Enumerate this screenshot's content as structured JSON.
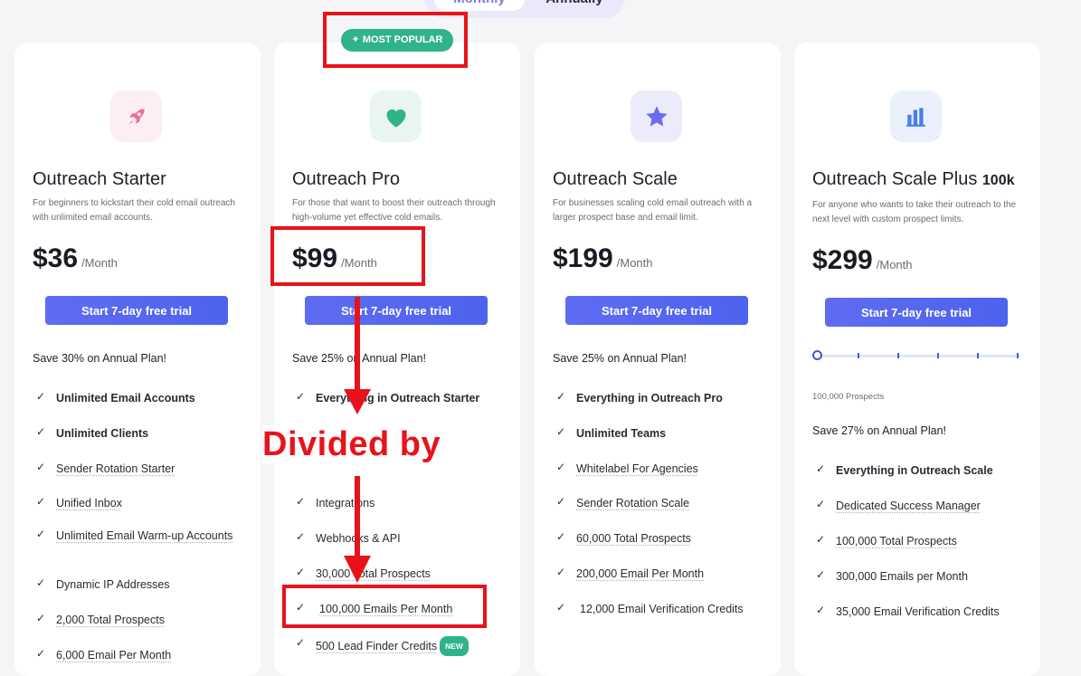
{
  "billing_toggle": {
    "monthly": "Monthly",
    "annually": "Annually"
  },
  "popular_badge": "MOST POPULAR",
  "plans": [
    {
      "name": "Outreach Starter",
      "name_suffix": "",
      "description": "For beginners to kickstart their cold email outreach with unlimited email accounts.",
      "price": "$36",
      "period": "/Month",
      "cta": "Start 7-day free trial",
      "save": "Save 30% on Annual Plan!",
      "features": [
        "Unlimited Email Accounts",
        "Unlimited Clients",
        "Sender Rotation Starter",
        "Unified Inbox",
        "Unlimited Email Warm-up Accounts",
        "Dynamic IP Addresses",
        "2,000 Total Prospects",
        "6,000 Email Per Month"
      ]
    },
    {
      "name": "Outreach Pro",
      "name_suffix": "",
      "description": "For those that want to boost their outreach through high-volume yet effective cold emails.",
      "price": "$99",
      "period": "/Month",
      "cta": "Start 7-day free trial",
      "save": "Save 25% on Annual Plan!",
      "features": [
        "Everything in Outreach Starter",
        "Integrations",
        "Webhooks & API",
        "30,000 Total Prospects",
        "100,000 Emails Per Month",
        "500 Lead Finder Credits"
      ],
      "new_badge": "NEW"
    },
    {
      "name": "Outreach Scale",
      "name_suffix": "",
      "description": "For businesses scaling cold email outreach with a larger prospect base and email limit.",
      "price": "$199",
      "period": "/Month",
      "cta": "Start 7-day free trial",
      "save": "Save 25% on Annual Plan!",
      "features": [
        "Everything in Outreach Pro",
        "Unlimited Teams",
        "Whitelabel For Agencies",
        "Sender Rotation Scale",
        "60,000 Total Prospects",
        "200,000 Email Per Month",
        "12,000 Email Verification Credits"
      ]
    },
    {
      "name": "Outreach Scale Plus",
      "name_suffix": "100k",
      "description": "For anyone who wants to take their outreach to the next level with custom prospect limits.",
      "price": "$299",
      "period": "/Month",
      "cta": "Start 7-day free trial",
      "prospects_label": "100,000 Prospects",
      "prospects_slider_fraction": 0,
      "save": "Save 27% on Annual Plan!",
      "features": [
        "Everything in Outreach Scale",
        "Dedicated Success Manager",
        "100,000 Total Prospects",
        "300,000 Emails per Month",
        "35,000 Email Verification Credits"
      ]
    }
  ],
  "annotation": {
    "text": "Divided by",
    "color": "#e8131a"
  },
  "colors": {
    "accent": "#4f63ef",
    "badge_green": "#2fb38a",
    "annotation_red": "#e8131a"
  }
}
